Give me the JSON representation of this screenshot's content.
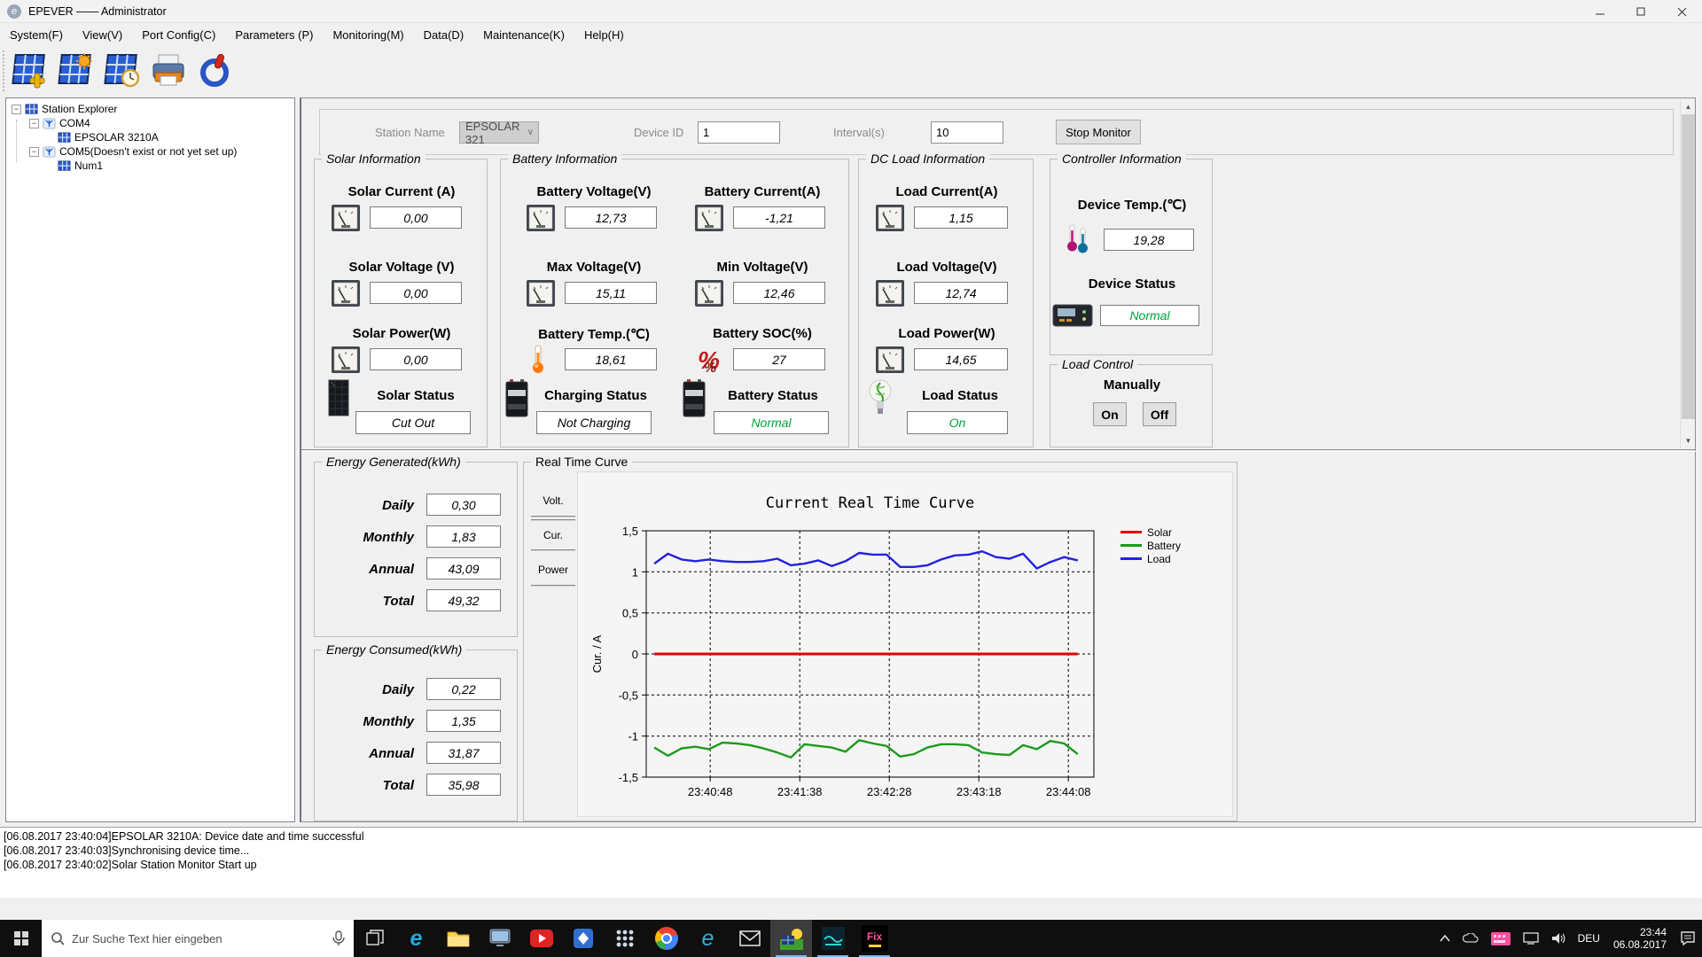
{
  "window": {
    "title": "EPEVER —— Administrator",
    "controls": [
      "minimize",
      "maximize",
      "close"
    ]
  },
  "menu": {
    "items": [
      "System(F)",
      "View(V)",
      "Port Config(C)",
      "Parameters (P)",
      "Monitoring(M)",
      "Data(D)",
      "Maintenance(K)",
      "Help(H)"
    ]
  },
  "toolbar": {
    "icons": [
      "add-station",
      "station-sun",
      "station-clock",
      "print",
      "power"
    ]
  },
  "tree": {
    "root": "Station Explorer",
    "com4": "COM4",
    "device": "EPSOLAR 3210A",
    "com5": "COM5(Doesn't exist or not yet set up)",
    "num1": "Num1"
  },
  "form": {
    "station_name_label": "Station Name",
    "station_name": "EPSOLAR 321",
    "device_id_label": "Device ID",
    "device_id": "1",
    "interval_label": "Interval(s)",
    "interval": "10",
    "stop_button": "Stop Monitor"
  },
  "solar": {
    "title": "Solar Information",
    "metrics": [
      {
        "label": "Solar Current (A)",
        "value": "0,00"
      },
      {
        "label": "Solar Voltage (V)",
        "value": "0,00"
      },
      {
        "label": "Solar Power(W)",
        "value": "0,00"
      }
    ],
    "status_label": "Solar Status",
    "status_value": "Cut Out"
  },
  "battery": {
    "title": "Battery Information",
    "metrics_left": [
      {
        "label": "Battery Voltage(V)",
        "value": "12,73"
      },
      {
        "label": "Max Voltage(V)",
        "value": "15,11"
      },
      {
        "label": "Battery Temp.(℃)",
        "value": "18,61"
      }
    ],
    "metrics_right": [
      {
        "label": "Battery Current(A)",
        "value": "-1,21"
      },
      {
        "label": "Min Voltage(V)",
        "value": "12,46"
      },
      {
        "label": "Battery SOC(%)",
        "value": "27"
      }
    ],
    "charging_status_label": "Charging Status",
    "charging_status_value": "Not Charging",
    "battery_status_label": "Battery Status",
    "battery_status_value": "Normal"
  },
  "dc_load": {
    "title": "DC Load Information",
    "metrics": [
      {
        "label": "Load Current(A)",
        "value": "1,15"
      },
      {
        "label": "Load Voltage(V)",
        "value": "12,74"
      },
      {
        "label": "Load Power(W)",
        "value": "14,65"
      }
    ],
    "status_label": "Load Status",
    "status_value": "On"
  },
  "controller": {
    "title": "Controller Information",
    "temp_label": "Device Temp.(℃)",
    "temp_value": "19,28",
    "status_label": "Device Status",
    "status_value": "Normal"
  },
  "load_control": {
    "title": "Load Control",
    "manually_label": "Manually",
    "on_button": "On",
    "off_button": "Off"
  },
  "energy_generated": {
    "title": "Energy Generated(kWh)",
    "rows": [
      {
        "label": "Daily",
        "value": "0,30"
      },
      {
        "label": "Monthly",
        "value": "1,83"
      },
      {
        "label": "Annual",
        "value": "43,09"
      },
      {
        "label": "Total",
        "value": "49,32"
      }
    ]
  },
  "energy_consumed": {
    "title": "Energy Consumed(kWh)",
    "rows": [
      {
        "label": "Daily",
        "value": "0,22"
      },
      {
        "label": "Monthly",
        "value": "1,35"
      },
      {
        "label": "Annual",
        "value": "31,87"
      },
      {
        "label": "Total",
        "value": "35,98"
      }
    ]
  },
  "realtime": {
    "title": "Real Time Curve",
    "tabs": [
      "Volt.",
      "Cur.",
      "Power"
    ]
  },
  "chart_data": {
    "type": "line",
    "title": "Current Real Time Curve",
    "xlabel": "",
    "ylabel": "Cur. / A",
    "ylim": [
      -1.5,
      1.5
    ],
    "ytick_values": [
      1.5,
      1,
      0.5,
      0,
      -0.5,
      -1,
      -1.5
    ],
    "ytick_labels": [
      "1,5",
      "1",
      "0,5",
      "0",
      "-0,5",
      "-1",
      "-1,5"
    ],
    "xtick_labels": [
      "23:40:48",
      "23:41:38",
      "23:42:28",
      "23:43:18",
      "23:44:08"
    ],
    "grid": true,
    "legend_position": "right",
    "series": [
      {
        "name": "Solar",
        "color": "#e60000",
        "values": [
          0,
          0,
          0,
          0,
          0,
          0,
          0,
          0,
          0,
          0,
          0,
          0,
          0,
          0,
          0,
          0,
          0,
          0,
          0,
          0,
          0,
          0,
          0,
          0,
          0,
          0,
          0,
          0,
          0,
          0,
          0,
          0
        ]
      },
      {
        "name": "Battery",
        "color": "#1d9a1d",
        "values": [
          -1.14,
          -1.24,
          -1.15,
          -1.13,
          -1.16,
          -1.08,
          -1.09,
          -1.11,
          -1.15,
          -1.2,
          -1.26,
          -1.1,
          -1.12,
          -1.14,
          -1.19,
          -1.05,
          -1.09,
          -1.12,
          -1.25,
          -1.22,
          -1.14,
          -1.1,
          -1.1,
          -1.11,
          -1.2,
          -1.22,
          -1.23,
          -1.11,
          -1.16,
          -1.06,
          -1.09,
          -1.22
        ]
      },
      {
        "name": "Load",
        "color": "#2222dd",
        "values": [
          1.1,
          1.22,
          1.15,
          1.13,
          1.15,
          1.13,
          1.12,
          1.12,
          1.13,
          1.16,
          1.08,
          1.1,
          1.14,
          1.07,
          1.13,
          1.23,
          1.21,
          1.21,
          1.06,
          1.06,
          1.08,
          1.15,
          1.2,
          1.21,
          1.25,
          1.18,
          1.16,
          1.22,
          1.04,
          1.12,
          1.18,
          1.14
        ]
      }
    ]
  },
  "log": {
    "lines": [
      "[06.08.2017 23:40:04]EPSOLAR 3210A: Device date and time successful",
      "[06.08.2017 23:40:03]Synchronising device time...",
      "[06.08.2017 23:40:02]Solar Station Monitor Start up"
    ]
  },
  "taskbar": {
    "search_placeholder": "Zur Suche Text hier eingeben",
    "fix_label": "Fix",
    "language": "DEU",
    "time": "23:44",
    "date": "06.08.2017"
  },
  "colors": {
    "status_ok": "#00a33e",
    "accent_blue": "#0078d7"
  }
}
